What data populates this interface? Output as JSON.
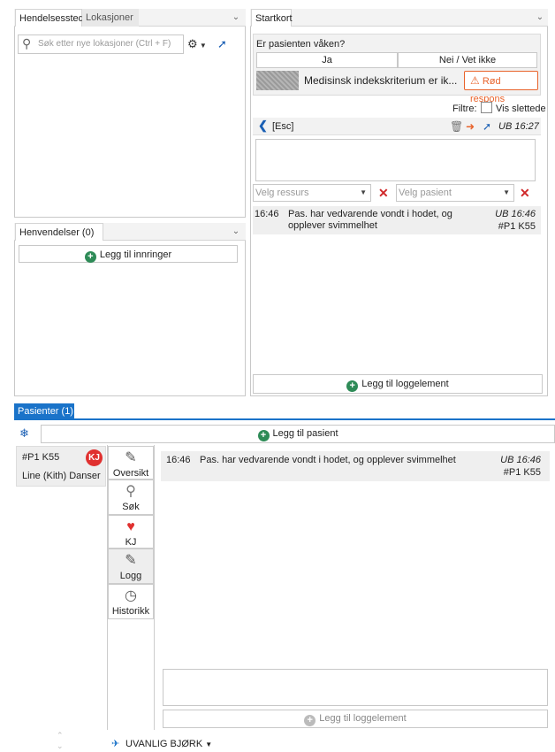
{
  "top_left": {
    "tabs": [
      "Hendelsessted",
      "Lokasjoner"
    ],
    "search_placeholder": "Søk etter nye lokasjoner (Ctrl + F)"
  },
  "henvendelser": {
    "title": "Henvendelser (0)",
    "add_button": "Legg til innringer"
  },
  "startkort": {
    "tab": "Startkort",
    "question": "Er pasienten våken?",
    "answer_yes": "Ja",
    "answer_no": "Nei / Vet ikke",
    "criterion": "Medisinsk indekskriterium er ik...",
    "respons": "Rød respons",
    "filter_label": "Filtre:",
    "filter_checkbox": "Vis slettede",
    "esc_label": "[Esc]",
    "entry_stamp": "UB 16:27",
    "resource_placeholder": "Velg ressurs",
    "patient_placeholder": "Velg pasient",
    "log_entry": {
      "time": "16:46",
      "text": "Pas. har vedvarende vondt i hodet, og opplever svimmelhet",
      "stamp": "UB 16:46",
      "patient": "#P1 K55"
    },
    "add_log_button": "Legg til loggelement"
  },
  "pasienter": {
    "tab": "Pasienter (1)",
    "add_patient_button": "Legg til pasient",
    "patient": {
      "id": "#P1 K55",
      "badge": "KJ",
      "name": "Line (Kith) Danser"
    },
    "side_nav": [
      "Oversikt",
      "Søk",
      "KJ",
      "Logg",
      "Historikk"
    ],
    "log_entry": {
      "time": "16:46",
      "text": "Pas. har vedvarende vondt i hodet, og opplever svimmelhet",
      "stamp": "UB 16:46",
      "patient": "#P1 K55"
    },
    "add_log_button": "Legg til loggelement",
    "footer_label": "UVANLIG BJØRK"
  },
  "colors": {
    "accent_blue": "#1a73c9",
    "badge_red": "#e0302f",
    "respons_orange": "#e8632b",
    "add_green": "#2e8b57"
  }
}
